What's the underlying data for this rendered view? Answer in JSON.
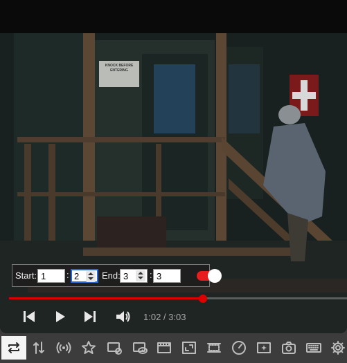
{
  "looper": {
    "start_label": "Start:",
    "start_minutes": "1",
    "start_seconds": "2",
    "end_label": "End:",
    "end_minutes": "3",
    "end_seconds": "3",
    "separator": ":",
    "loop_enabled": true,
    "toggle_color": "#e81e1e"
  },
  "player": {
    "current_time": "1:02",
    "duration": "3:03",
    "time_separator": " / ",
    "progress_fraction": 0.573,
    "progress_color": "#dd0000"
  },
  "video_scene": {
    "sign_line1": "KNOCK BEFORE",
    "sign_line2": "ENTERING"
  },
  "toolbar": {
    "items": [
      {
        "icon": "repeat-icon",
        "active": true
      },
      {
        "icon": "sort-arrows-icon",
        "active": false
      },
      {
        "icon": "broadcast-icon",
        "active": false
      },
      {
        "icon": "star-icon",
        "active": false
      },
      {
        "icon": "no-ads-icon",
        "active": false
      },
      {
        "icon": "eye-screen-icon",
        "active": false
      },
      {
        "icon": "cinema-icon",
        "active": false
      },
      {
        "icon": "resize-icon",
        "active": false
      },
      {
        "icon": "wide-screen-icon",
        "active": false
      },
      {
        "icon": "speed-gauge-icon",
        "active": false
      },
      {
        "icon": "sparkle-screen-icon",
        "active": false
      },
      {
        "icon": "camera-icon",
        "active": false
      },
      {
        "icon": "keyboard-icon",
        "active": false
      },
      {
        "icon": "gear-icon",
        "active": false
      }
    ]
  }
}
